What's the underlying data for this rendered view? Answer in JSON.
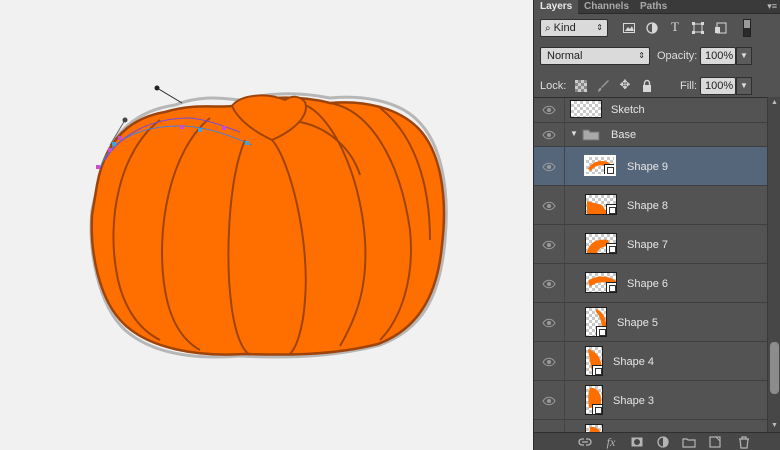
{
  "canvas": {
    "pumpkin_color": "#ff6f00",
    "outline_color": "#9e4309",
    "sketch_color": "#b7b7b7"
  },
  "panel": {
    "tabs": [
      "Layers",
      "Channels",
      "Paths"
    ],
    "active_tab": "Layers",
    "filter": {
      "label": "Kind"
    },
    "blend_mode": "Normal",
    "opacity_label": "Opacity:",
    "opacity_value": "100%",
    "lock_label": "Lock:",
    "fill_label": "Fill:",
    "fill_value": "100%",
    "layers": [
      {
        "name": "Sketch",
        "type": "pixel"
      },
      {
        "name": "Base",
        "type": "group"
      },
      {
        "name": "Shape 9",
        "type": "shape",
        "selected": true
      },
      {
        "name": "Shape 8",
        "type": "shape"
      },
      {
        "name": "Shape 7",
        "type": "shape"
      },
      {
        "name": "Shape 6",
        "type": "shape"
      },
      {
        "name": "Shape 5",
        "type": "shape"
      },
      {
        "name": "Shape 4",
        "type": "shape"
      },
      {
        "name": "Shape 3",
        "type": "shape"
      }
    ],
    "accent_selected": "#55657a"
  }
}
